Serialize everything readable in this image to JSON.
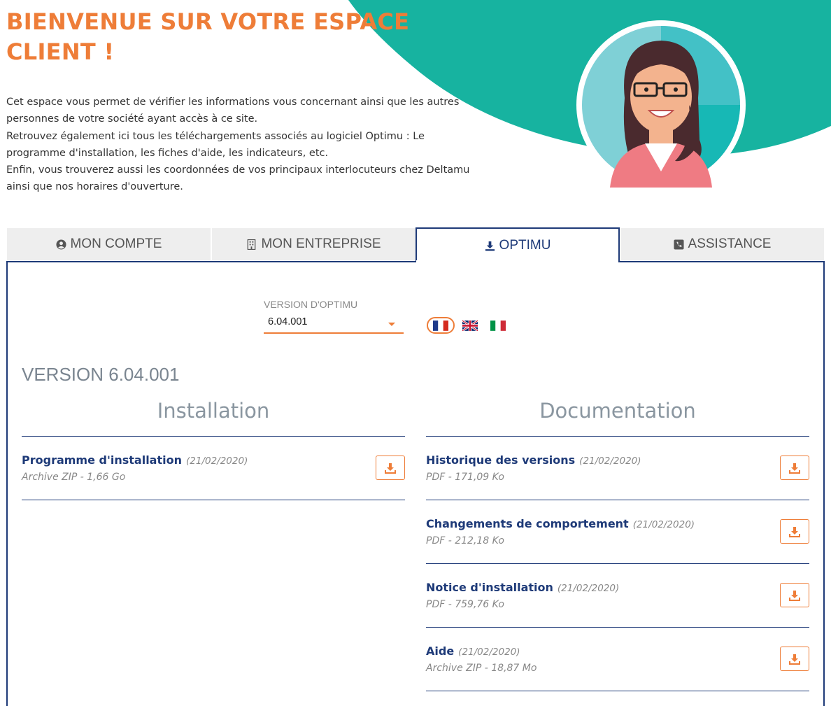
{
  "hero": {
    "title_line1": "BIENVENUE SUR VOTRE ESPACE",
    "title_line2": "CLIENT !",
    "intro_lines": [
      "Cet espace vous permet de vérifier les informations vous concernant ainsi que les autres",
      "personnes de votre société ayant accès à ce site.",
      "Retrouvez également ici tous les téléchargements associés au logiciel Optimu : Le",
      "programme d'installation, les fiches d'aide, les indicateurs, etc.",
      "Enfin, vous trouverez aussi les coordonnées de vos principaux interlocuteurs chez Deltamu",
      "ainsi que nos horaires d'ouverture."
    ],
    "accent_color": "#ee7d38",
    "teal_color": "#17b3a0"
  },
  "tabs": [
    {
      "label": "MON COMPTE",
      "icon": "user-circle-icon",
      "active": false
    },
    {
      "label": "MON ENTREPRISE",
      "icon": "building-icon",
      "active": false
    },
    {
      "label": "OPTIMU",
      "icon": "download-icon",
      "active": true
    },
    {
      "label": "ASSISTANCE",
      "icon": "phone-square-icon",
      "active": false
    }
  ],
  "optimu": {
    "version_label": "VERSION D'OPTIMU",
    "version_value": "6.04.001",
    "languages": [
      {
        "name": "french-flag-icon",
        "selected": true
      },
      {
        "name": "uk-flag-icon",
        "selected": false
      },
      {
        "name": "italian-flag-icon",
        "selected": false
      }
    ],
    "version_heading": "VERSION 6.04.001",
    "installation": {
      "heading": "Installation",
      "items": [
        {
          "title": "Programme d'installation",
          "date": "(21/02/2020)",
          "meta": "Archive ZIP - 1,66 Go"
        }
      ]
    },
    "documentation": {
      "heading": "Documentation",
      "items": [
        {
          "title": "Historique des versions",
          "date": "(21/02/2020)",
          "meta": "PDF - 171,09 Ko"
        },
        {
          "title": "Changements de comportement",
          "date": "(21/02/2020)",
          "meta": "PDF - 212,18 Ko"
        },
        {
          "title": "Notice d'installation",
          "date": "(21/02/2020)",
          "meta": "PDF - 759,76 Ko"
        },
        {
          "title": "Aide",
          "date": "(21/02/2020)",
          "meta": "Archive ZIP - 18,87 Mo"
        }
      ]
    }
  }
}
